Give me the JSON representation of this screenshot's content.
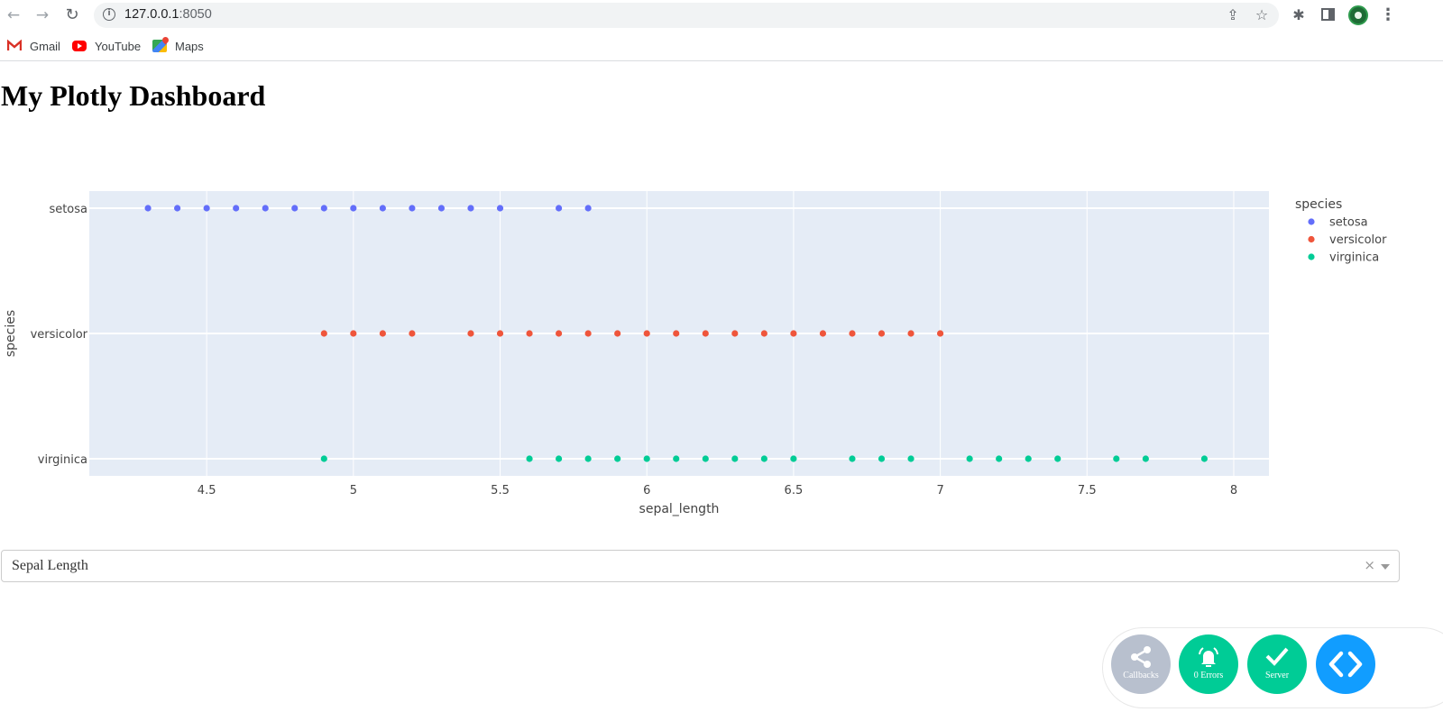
{
  "browser": {
    "url_host": "127.0.0.1",
    "url_port": ":8050",
    "bookmarks": [
      {
        "label": "Gmail",
        "icon": "gmail-icon"
      },
      {
        "label": "YouTube",
        "icon": "youtube-icon"
      },
      {
        "label": "Maps",
        "icon": "maps-icon"
      }
    ]
  },
  "page": {
    "title": "My Plotly Dashboard"
  },
  "dropdown": {
    "selected": "Sepal Length",
    "clear_glyph": "×"
  },
  "debug_menu": {
    "callbacks_label": "Callbacks",
    "errors_label": "0 Errors",
    "server_label": "Server",
    "colors": {
      "callbacks": "#b8c0ce",
      "errors": "#00cc96",
      "server": "#00cc96",
      "toggle": "#119dff"
    }
  },
  "chart_data": {
    "type": "scatter",
    "title": "",
    "xlabel": "sepal_length",
    "ylabel": "species",
    "xlim": [
      4.1,
      8.12
    ],
    "x_ticks": [
      4.5,
      5,
      5.5,
      6,
      6.5,
      7,
      7.5,
      8
    ],
    "x_tick_labels": [
      "4.5",
      "5",
      "5.5",
      "6",
      "6.5",
      "7",
      "7.5",
      "8"
    ],
    "categories": [
      "setosa",
      "versicolor",
      "virginica"
    ],
    "grid": true,
    "plot_bgcolor": "#e5ecf6",
    "legend": {
      "title": "species",
      "placement": "right"
    },
    "series": [
      {
        "name": "setosa",
        "color": "#636efa",
        "x": [
          4.3,
          4.4,
          4.5,
          4.6,
          4.7,
          4.8,
          4.9,
          5.0,
          5.1,
          5.2,
          5.3,
          5.4,
          5.5,
          5.7,
          5.8
        ]
      },
      {
        "name": "versicolor",
        "color": "#ef553b",
        "x": [
          4.9,
          5.0,
          5.1,
          5.2,
          5.4,
          5.5,
          5.6,
          5.7,
          5.8,
          5.9,
          6.0,
          6.1,
          6.2,
          6.3,
          6.4,
          6.5,
          6.6,
          6.7,
          6.8,
          6.9,
          7.0
        ]
      },
      {
        "name": "virginica",
        "color": "#00cc96",
        "x": [
          4.9,
          5.6,
          5.7,
          5.8,
          5.9,
          6.0,
          6.1,
          6.2,
          6.3,
          6.4,
          6.5,
          6.7,
          6.8,
          6.9,
          7.1,
          7.2,
          7.3,
          7.4,
          7.6,
          7.7,
          7.9
        ]
      }
    ]
  }
}
